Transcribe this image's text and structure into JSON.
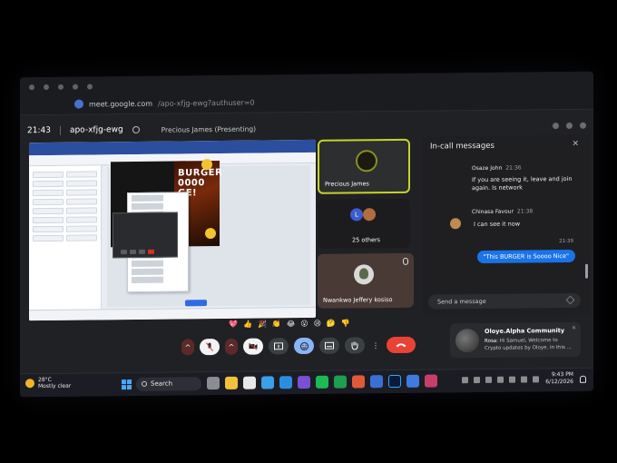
{
  "browser": {
    "url": "meet.google.com",
    "path": "/apo-xfjg-ewg?authuser=0"
  },
  "meet": {
    "time": "21:43",
    "code": "apo-xfjg-ewg",
    "presenter_label": "Precious James (Presenting)"
  },
  "presentation": {
    "promo_text": "BURGER 0000 GE!"
  },
  "tiles": [
    {
      "name": "Precious James"
    },
    {
      "name": "25 others",
      "avatar_letter": "L"
    },
    {
      "name": "Nwankwo Jeffery kosiso"
    }
  ],
  "chat": {
    "title": "In-call messages",
    "messages": [
      {
        "author": "Osaze John",
        "time": "21:36",
        "text": "If you are seeing it, leave and join again. Is network"
      },
      {
        "author": "Chinasa Favour",
        "time": "21:38",
        "text": "I can see it now"
      }
    ],
    "own_time": "21:39",
    "own_message": "\"This BURGER is Soooo Nice\"",
    "input_placeholder": "Send a message"
  },
  "reactions": [
    "💖",
    "👍",
    "🎉",
    "👏",
    "😂",
    "😮",
    "😢",
    "🤔",
    "👎"
  ],
  "notification": {
    "title": "Oloye.Alpha Community",
    "sender": "Rosa:",
    "text": "Hi Samuel, Welcome to Crypto updates by Oloye. In this ..."
  },
  "taskbar": {
    "temp": "28°C",
    "weather": "Mostly clear",
    "search": "Search",
    "time": "9:43 PM",
    "date": "6/12/2026"
  },
  "colors": {
    "end_call": "#ea4335",
    "active_speaker": "#c7d22a",
    "own_bubble": "#1a73e8"
  }
}
